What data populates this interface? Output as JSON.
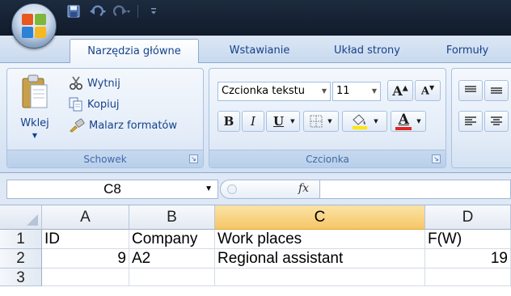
{
  "ribbon_tabs": [
    {
      "label": "Narzędzia główne",
      "active": true
    },
    {
      "label": "Wstawianie"
    },
    {
      "label": "Układ strony"
    },
    {
      "label": "Formuły"
    }
  ],
  "clipboard": {
    "paste": "Wklej",
    "cut": "Wytnij",
    "copy": "Kopiuj",
    "format_painter": "Malarz formatów",
    "group_label": "Schowek"
  },
  "font": {
    "name": "Czcionka tekstu",
    "size": "11",
    "bold": "B",
    "italic": "I",
    "underline": "U",
    "font_color_letter": "A",
    "group_label": "Czcionka",
    "font_color": "#e3261c",
    "highlight_color": "#ffe600"
  },
  "formula_bar": {
    "name_box": "C8",
    "fx": "fx",
    "formula": ""
  },
  "grid": {
    "column_headers": [
      "A",
      "B",
      "C",
      "D"
    ],
    "selected_column": "C",
    "row_headers": [
      "1",
      "2",
      "3"
    ],
    "rows": [
      [
        "ID",
        "Company",
        "Work places",
        "F(W)"
      ],
      [
        "9",
        "A2",
        "Regional assistant",
        "19"
      ],
      [
        "",
        "",
        "",
        ""
      ]
    ]
  }
}
